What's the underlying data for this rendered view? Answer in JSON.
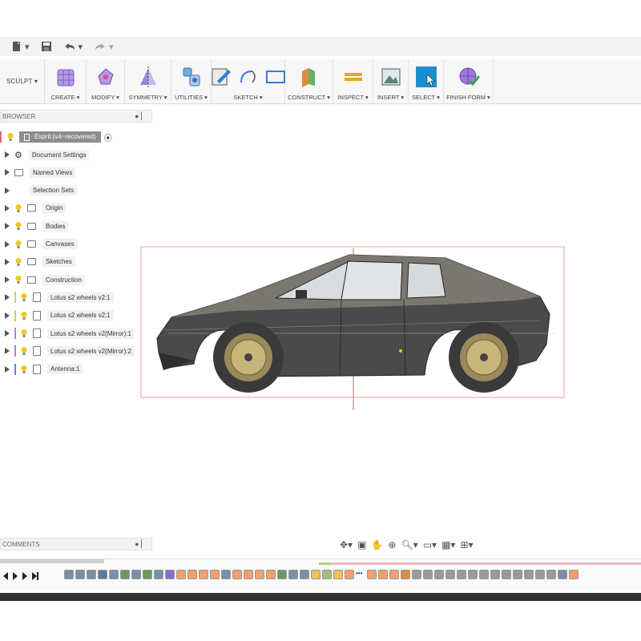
{
  "quick_access": {
    "items": [
      "file-icon",
      "save-icon",
      "undo-icon",
      "redo-icon"
    ]
  },
  "ribbon": {
    "workspace": "SCULPT ▾",
    "groups": [
      {
        "label": "CREATE ▾",
        "icon": "create-form-icon",
        "color": "#a487d8"
      },
      {
        "label": "MODIFY ▾",
        "icon": "modify-icon",
        "color": "#9b6fd1"
      },
      {
        "label": "SYMMETRY ▾",
        "icon": "symmetry-icon",
        "color": "#7b5fc8"
      },
      {
        "label": "UTILITIES ▾",
        "icon": "utilities-icon",
        "color": "#5b8fd0"
      },
      {
        "label": "SKETCH ▾",
        "icon": "sketch-icon",
        "color": "#3c7bd6"
      },
      {
        "label": "CONSTRUCT ▾",
        "icon": "construct-icon",
        "color": "#e38a3c"
      },
      {
        "label": "INSPECT ▾",
        "icon": "inspect-icon",
        "color": "#e0a92c"
      },
      {
        "label": "INSERT ▾",
        "icon": "insert-icon",
        "color": "#4f8a6e"
      },
      {
        "label": "SELECT ▾",
        "icon": "select-icon",
        "color": "#1a8fcf"
      },
      {
        "label": "FINISH FORM ▾",
        "icon": "finish-form-icon",
        "color": "#8e58c8"
      }
    ]
  },
  "browser": {
    "title": "BROWSER",
    "root": "Esprit (v4~recovered)",
    "nodes": [
      {
        "label": "Document Settings",
        "bulb": false,
        "kind": "gear",
        "bar": ""
      },
      {
        "label": "Named Views",
        "bulb": false,
        "kind": "folder",
        "bar": ""
      },
      {
        "label": "Selection Sets",
        "bulb": false,
        "kind": "none",
        "bar": ""
      },
      {
        "label": "Origin",
        "bulb": true,
        "kind": "folder",
        "bar": ""
      },
      {
        "label": "Bodies",
        "bulb": true,
        "kind": "folder",
        "bar": ""
      },
      {
        "label": "Canvases",
        "bulb": true,
        "kind": "folder",
        "bar": ""
      },
      {
        "label": "Sketches",
        "bulb": true,
        "kind": "folder",
        "bar": ""
      },
      {
        "label": "Construction",
        "bulb": true,
        "kind": "folder",
        "bar": ""
      },
      {
        "label": "Lotus s2 wheels v2:1",
        "bulb": true,
        "kind": "component",
        "bar": "#b7d96b"
      },
      {
        "label": "Lotus s2 wheels v2:1",
        "bulb": true,
        "kind": "component",
        "bar": "#b7d96b"
      },
      {
        "label": "Lotus s2 wheels v2(Mirror):1",
        "bulb": true,
        "kind": "component",
        "bar": "#c07ad6"
      },
      {
        "label": "Lotus s2 wheels v2(Mirror):2",
        "bulb": true,
        "kind": "component",
        "bar": "#c07ad6"
      },
      {
        "label": "Antenna:1",
        "bulb": true,
        "kind": "component",
        "bar": "#6d7ed8"
      }
    ]
  },
  "comments": {
    "title": "COMMENTS"
  },
  "nav_bar": {
    "items": [
      "orbit-icon",
      "look-at-icon",
      "pan-icon",
      "zoom-fit-icon",
      "zoom-icon",
      "display-settings-icon",
      "grid-icon",
      "viewports-icon"
    ]
  },
  "timeline": {
    "controls": [
      "go-start-icon",
      "step-back-icon",
      "play-icon",
      "step-forward-icon",
      "go-end-icon"
    ],
    "feature_colors": [
      "#7a8fa3",
      "#7a8fa3",
      "#7a8fa3",
      "#5e7a9a",
      "#7a8fa3",
      "#6a9a5e",
      "#7a8fa3",
      "#6a9a5e",
      "#7a8fa3",
      "#8d6ad1",
      "#f0a06e",
      "#f0a06e",
      "#f0a06e",
      "#f0a06e",
      "#7a8fa3",
      "#f0a06e",
      "#f0a06e",
      "#f0a06e",
      "#f0a06e",
      "#6a9a5e",
      "#7a8fa3",
      "#7a8fa3",
      "#e9c25a",
      "#9fc07a",
      "#e9c25a",
      "#f0a06e",
      "#f0a06e",
      "#f0a06e",
      "#f0a06e",
      "#e38a3c",
      "#9a9a9a",
      "#9a9a9a",
      "#9a9a9a",
      "#9a9a9a",
      "#9a9a9a",
      "#9a9a9a",
      "#9a9a9a",
      "#9a9a9a",
      "#9a9a9a",
      "#9a9a9a",
      "#9a9a9a",
      "#9a9a9a",
      "#9a9a9a",
      "#7a8fa3",
      "#f0a06e"
    ]
  }
}
